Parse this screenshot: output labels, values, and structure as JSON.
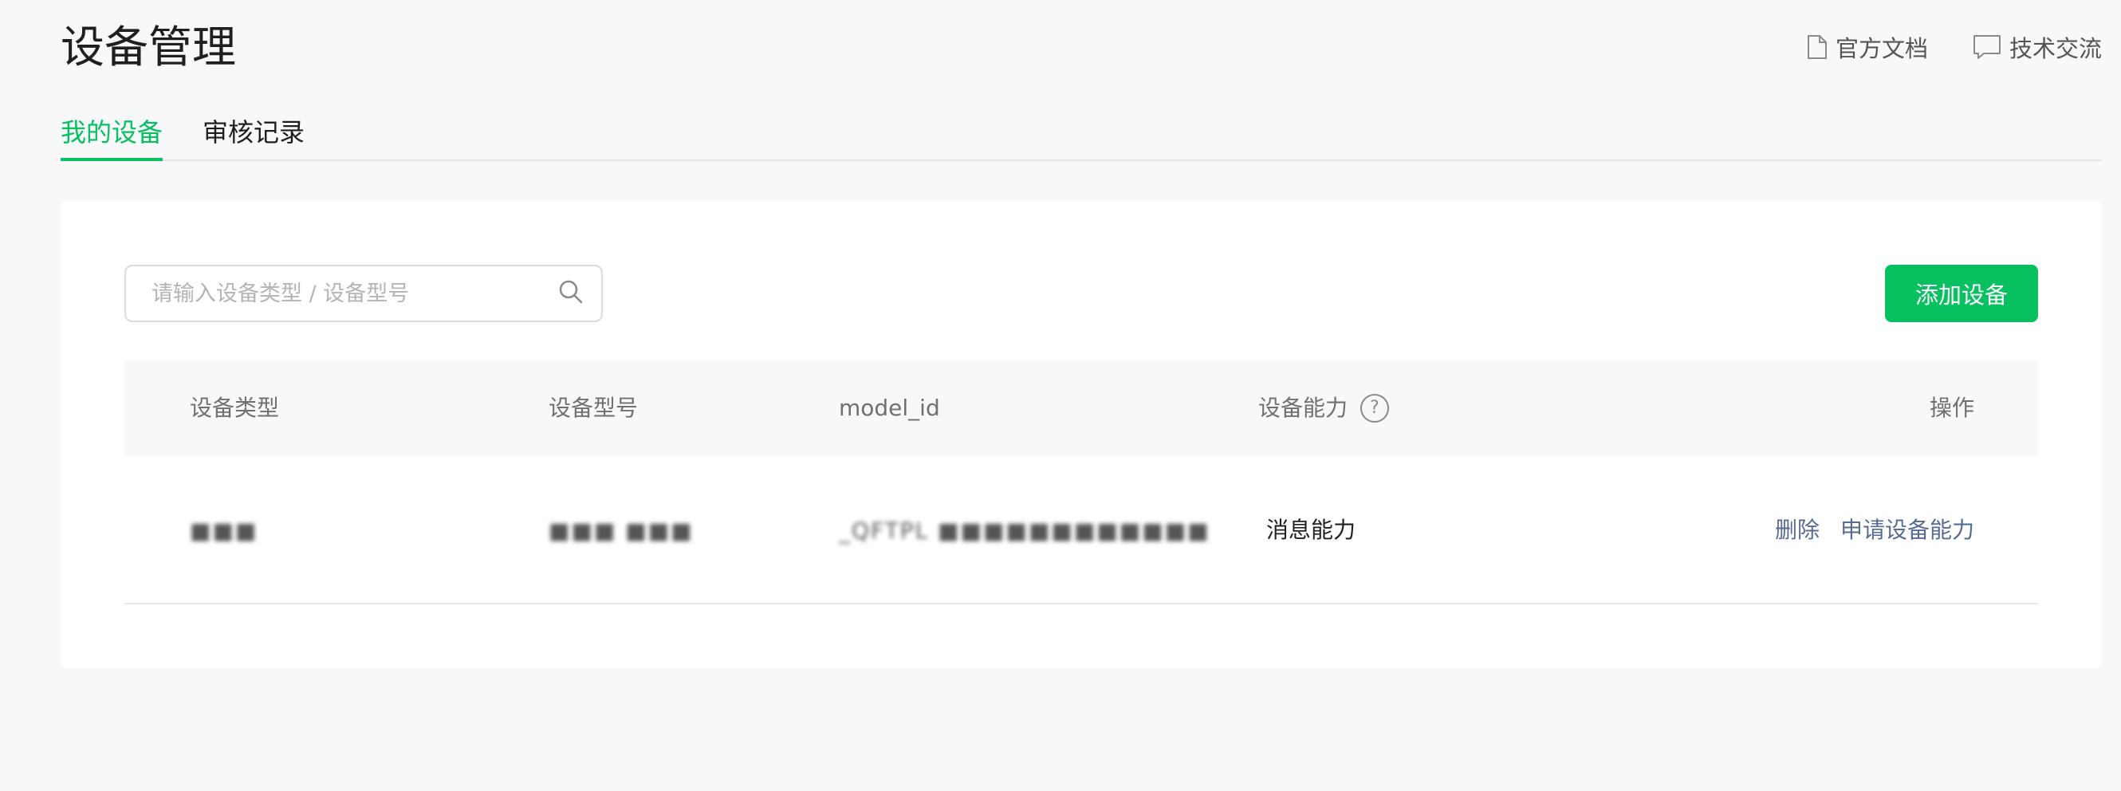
{
  "header": {
    "title": "设备管理",
    "links": [
      {
        "label": "官方文档",
        "icon": "document-icon"
      },
      {
        "label": "技术交流",
        "icon": "chat-icon"
      }
    ]
  },
  "tabs": [
    {
      "label": "我的设备",
      "active": true
    },
    {
      "label": "审核记录",
      "active": false
    }
  ],
  "toolbar": {
    "search_placeholder": "请输入设备类型 / 设备型号",
    "add_button": "添加设备"
  },
  "table": {
    "columns": [
      "设备类型",
      "设备型号",
      "model_id",
      "设备能力",
      "操作"
    ],
    "help_icon": "?",
    "rows": [
      {
        "device_type": "■■■",
        "device_model": "■■■ ■■■",
        "model_id": "_QFTPL ■■■■■■■■■■■■",
        "capability": "消息能力",
        "actions": [
          "删除",
          "申请设备能力"
        ]
      }
    ]
  },
  "colors": {
    "accent": "#07c160",
    "link": "#576b95",
    "background": "#f7f8fa"
  }
}
